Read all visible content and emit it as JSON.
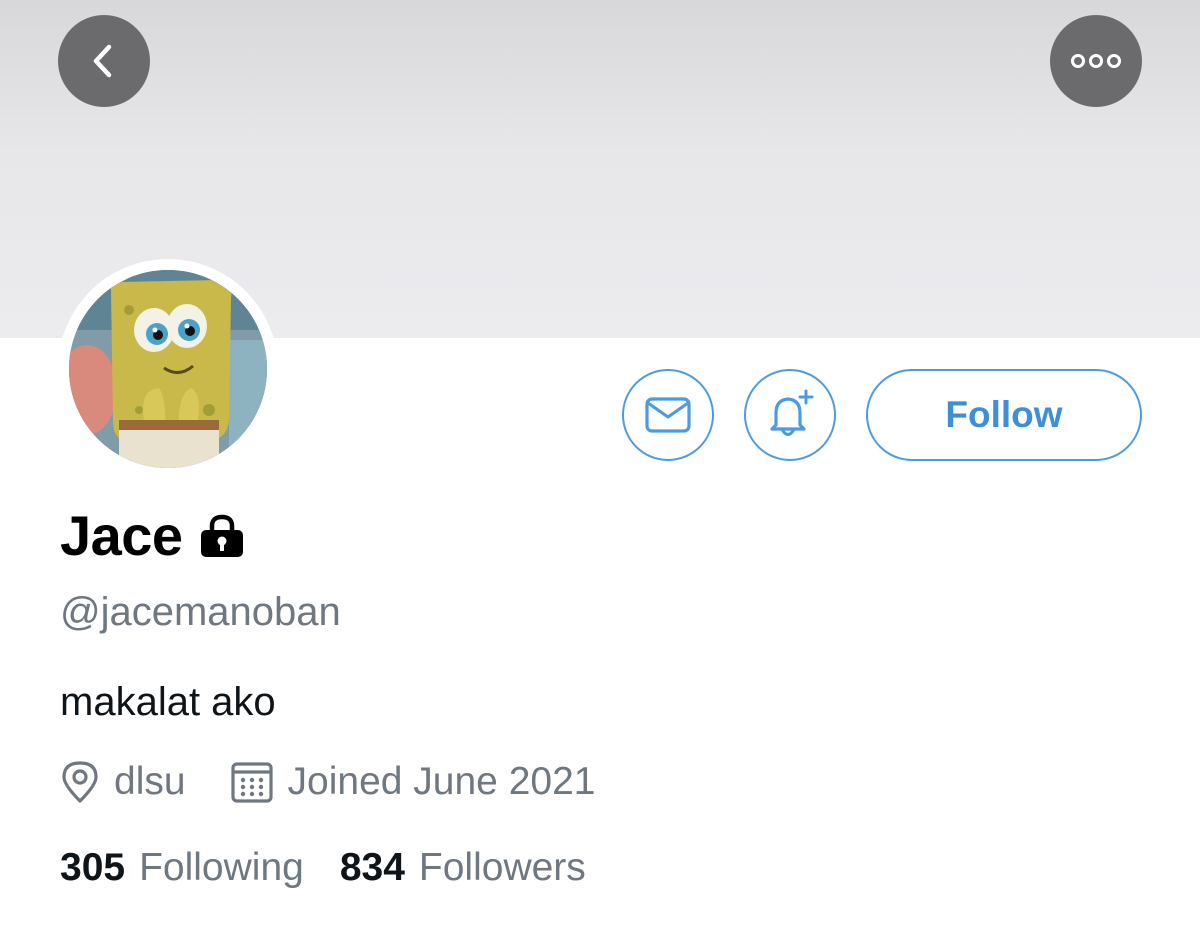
{
  "header": {
    "back_icon": "chevron-left-icon",
    "more_icon": "more-horizontal-icon"
  },
  "profile": {
    "display_name": "Jace",
    "protected_icon": "lock-icon",
    "handle": "@jacemanoban",
    "bio": "makalat ako",
    "location": "dlsu",
    "location_icon": "location-pin-icon",
    "joined": "Joined June 2021",
    "joined_icon": "calendar-icon"
  },
  "actions": {
    "message_icon": "envelope-icon",
    "notify_icon": "bell-plus-icon",
    "follow_label": "Follow"
  },
  "stats": {
    "following_count": "305",
    "following_label": "Following",
    "followers_count": "834",
    "followers_label": "Followers"
  },
  "colors": {
    "accent": "#4a9be0",
    "secondary_text": "#6f7780",
    "overlay_button": "#6b6b6d"
  }
}
